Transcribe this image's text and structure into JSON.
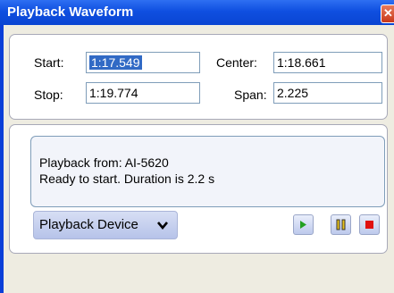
{
  "window": {
    "title": "Playback Waveform"
  },
  "fields": {
    "start_label": "Start:",
    "start_value": "1:17.549",
    "stop_label": "Stop:",
    "stop_value": "1:19.774",
    "center_label": "Center:",
    "center_value": "1:18.661",
    "span_label": "Span:",
    "span_value": "2.225"
  },
  "status": {
    "line1": "Playback from:  AI-5620",
    "line2": "Ready to start.  Duration is 2.2 s"
  },
  "device": {
    "label": "Playback Device"
  },
  "icons": {
    "play": "play-icon",
    "pause": "pause-icon",
    "stop": "stop-icon",
    "close": "close-icon",
    "dropdown": "chevron-down-icon"
  },
  "colors": {
    "title_bar": "#0f4fe0",
    "selection": "#316ac5",
    "play": "#22a020",
    "pause_fill": "#e8c21a",
    "stop": "#e01010"
  }
}
